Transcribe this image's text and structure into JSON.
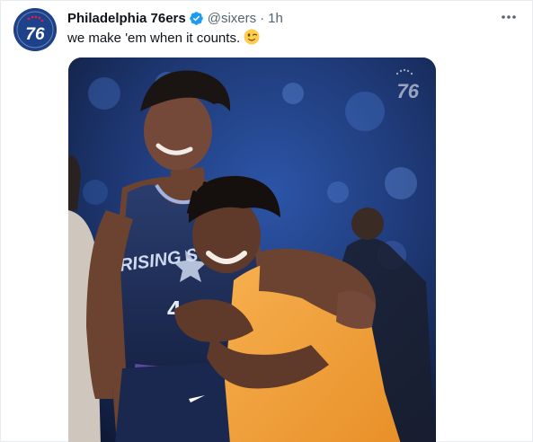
{
  "tweet": {
    "display_name": "Philadelphia 76ers",
    "handle": "@sixers",
    "separator": "·",
    "time": "1h",
    "text": "we make 'em when it counts.",
    "emoji": "winking-face-emoji"
  },
  "avatar": {
    "label": "76",
    "icon": "sixers-logo-icon",
    "colors": {
      "background": "#1d428a",
      "text": "#ffffff",
      "accent": "#ed174c"
    }
  },
  "media": {
    "watermark": "76",
    "jersey_text": "RISING STARS",
    "jersey_number": "4",
    "colors": {
      "navy_jersey": "#1e2f59",
      "orange_jersey": "#f5a23b",
      "background_blue": "#1e3a78"
    }
  },
  "icons": {
    "verified": "verified-badge-icon",
    "more": "more-options-icon"
  },
  "colors": {
    "verified_blue": "#1d9bf0",
    "secondary_text": "#536471",
    "primary_text": "#0f1419"
  }
}
